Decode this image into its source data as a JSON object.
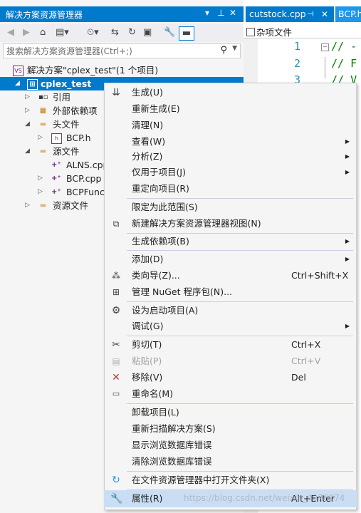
{
  "solution_explorer": {
    "title": "解决方案资源管理器",
    "title_icons": [
      "▾",
      "⊓",
      "✕"
    ],
    "search_placeholder": "搜索解决方案资源管理器(Ctrl+;)",
    "tree": [
      {
        "label": "解决方案\"cplex_test\"(1 个项目)",
        "icon": "solution-icon"
      },
      {
        "label": "cplex_test",
        "icon": "project-icon",
        "selected": true
      },
      {
        "label": "引用",
        "icon": "references-icon"
      },
      {
        "label": "外部依赖项",
        "icon": "external-deps-icon"
      },
      {
        "label": "头文件",
        "icon": "folder-icon"
      },
      {
        "label": "BCP.h",
        "icon": "header-file-icon"
      },
      {
        "label": "源文件",
        "icon": "folder-icon"
      },
      {
        "label": "ALNS.cpp",
        "icon": "cpp-file-icon"
      },
      {
        "label": "BCP.cpp",
        "icon": "cpp-file-icon"
      },
      {
        "label": "BCPFunc.c",
        "icon": "cpp-file-icon"
      },
      {
        "label": "资源文件",
        "icon": "folder-icon"
      }
    ]
  },
  "editor": {
    "tabs": [
      "cutstock.cpp",
      "BCP.h"
    ],
    "nav_label": "杂项文件",
    "line_numbers": [
      "1",
      "2",
      "3"
    ],
    "code_lines": [
      "// -",
      "// F",
      "// V"
    ]
  },
  "context_menu": {
    "items": [
      {
        "label": "生成(U)",
        "icon": "build-icon"
      },
      {
        "label": "重新生成(E)"
      },
      {
        "label": "清理(N)"
      },
      {
        "label": "查看(W)",
        "submenu": true
      },
      {
        "label": "分析(Z)",
        "submenu": true
      },
      {
        "label": "仅用于项目(J)",
        "submenu": true
      },
      {
        "label": "重定向项目(R)"
      },
      {
        "label": "限定为此范围(S)"
      },
      {
        "label": "新建解决方案资源管理器视图(N)",
        "icon": "new-view-icon"
      },
      {
        "label": "生成依赖项(B)",
        "submenu": true
      },
      {
        "label": "添加(D)",
        "submenu": true
      },
      {
        "label": "类向导(Z)...",
        "icon": "class-wizard-icon",
        "shortcut": "Ctrl+Shift+X"
      },
      {
        "label": "管理 NuGet 程序包(N)...",
        "icon": "nuget-icon"
      },
      {
        "label": "设为启动项目(A)",
        "icon": "gear-icon"
      },
      {
        "label": "调试(G)",
        "submenu": true
      },
      {
        "label": "剪切(T)",
        "icon": "scissors-icon",
        "shortcut": "Ctrl+X"
      },
      {
        "label": "粘贴(P)",
        "icon": "paste-icon",
        "shortcut": "Ctrl+V",
        "disabled": true
      },
      {
        "label": "移除(V)",
        "icon": "remove-icon",
        "shortcut": "Del"
      },
      {
        "label": "重命名(M)",
        "icon": "rename-icon"
      },
      {
        "label": "卸载项目(L)"
      },
      {
        "label": "重新扫描解决方案(S)"
      },
      {
        "label": "显示浏览数据库错误"
      },
      {
        "label": "清除浏览数据库错误"
      },
      {
        "label": "在文件资源管理器中打开文件夹(X)",
        "icon": "open-folder-icon"
      },
      {
        "label": "属性(R)",
        "icon": "wrench-icon",
        "shortcut": "Alt+Enter"
      }
    ]
  },
  "watermark": "https://blog.csdn.net/weixin_4076074",
  "colors": {
    "accent": "#007acc",
    "menu_bg": "#f5f5f5",
    "hover": "#c9def5",
    "remove": "#c0392b"
  }
}
